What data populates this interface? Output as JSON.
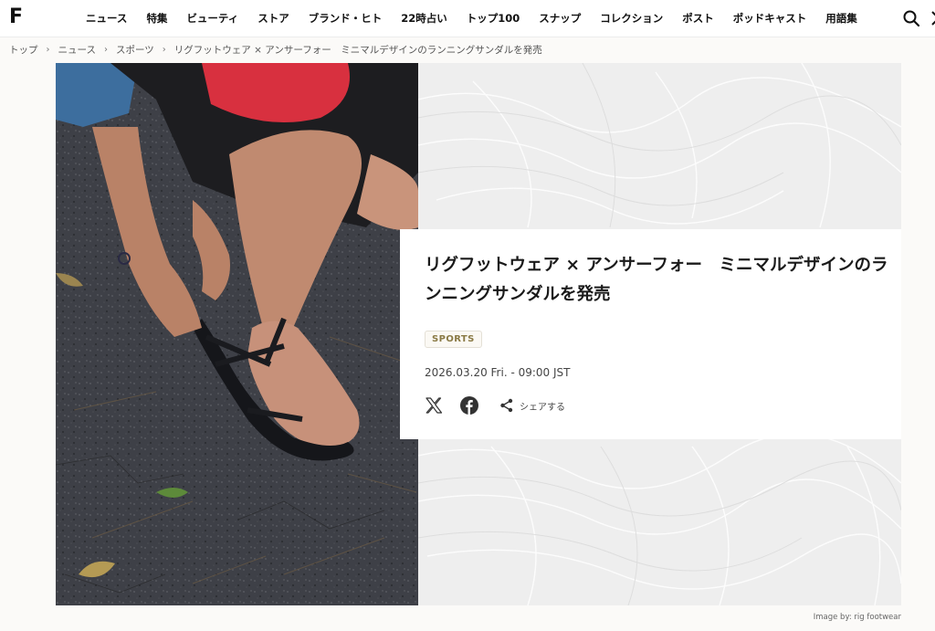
{
  "header": {
    "logo": "F",
    "nav": [
      "ニュース",
      "特集",
      "ビューティ",
      "ストア",
      "ブランド・ヒト",
      "22時占い",
      "トップ100",
      "スナップ",
      "コレクション",
      "ポスト",
      "ポッドキャスト",
      "用語集"
    ]
  },
  "breadcrumb": [
    "トップ",
    "ニュース",
    "スポーツ",
    "リグフットウェア × アンサーフォー　ミニマルデザインのランニングサンダルを発売"
  ],
  "article": {
    "title": "リグフットウェア × アンサーフォー　ミニマルデザインのランニングサンダルを発売",
    "tag": "SPORTS",
    "date": "2026.03.20 Fri. - 09:00 JST",
    "share_label": "シェアする",
    "image_credit": "Image by: rig footwear"
  },
  "icons": [
    "search-icon",
    "x-icon",
    "facebook-icon",
    "share-icon"
  ]
}
